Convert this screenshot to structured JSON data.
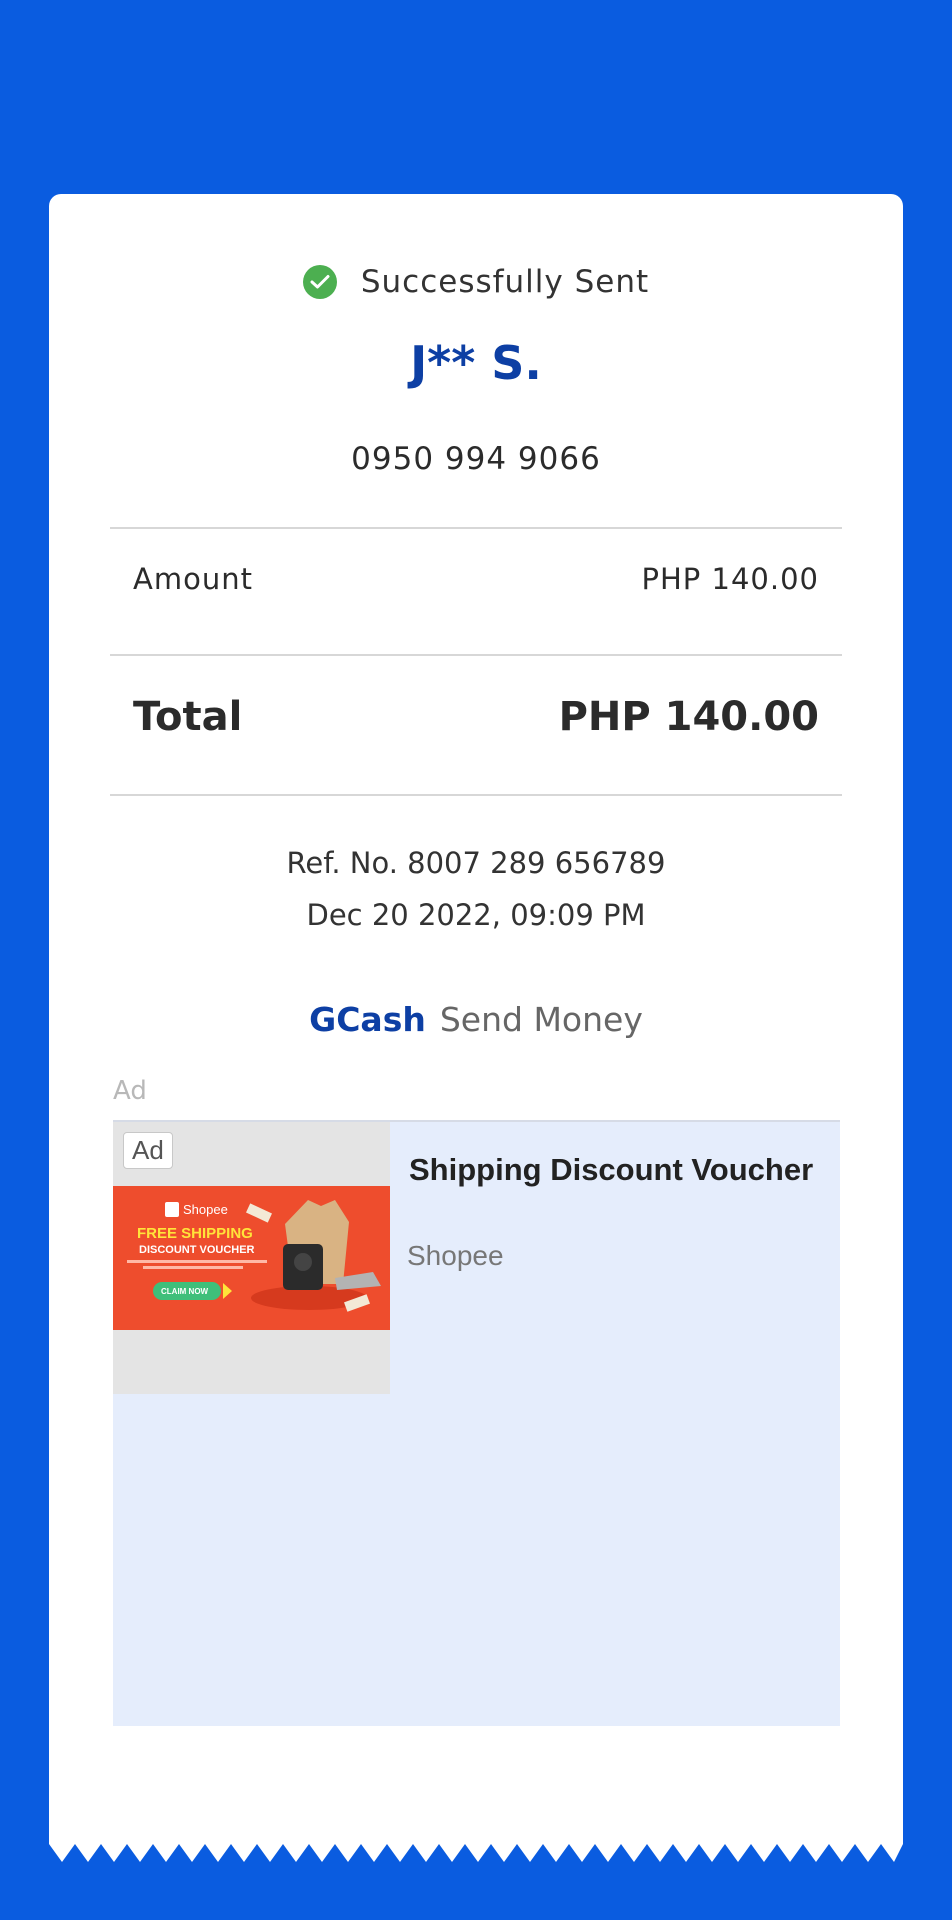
{
  "status": {
    "text": "Successfully Sent",
    "icon": "check-circle-icon",
    "color": "#4caf50"
  },
  "recipient": {
    "name": "J** S.",
    "phone": "0950 994 9066"
  },
  "amount": {
    "label": "Amount",
    "value": "PHP 140.00"
  },
  "total": {
    "label": "Total",
    "value": "PHP 140.00"
  },
  "reference": {
    "ref_no": "Ref. No. 8007 289 656789",
    "datetime": "Dec 20 2022, 09:09 PM"
  },
  "brand": {
    "name": "GCash",
    "service": "Send Money",
    "color": "#0d3fa4"
  },
  "ad": {
    "section_label": "Ad",
    "badge": "Ad",
    "title": "Shipping Discount Voucher",
    "advertiser": "Shopee",
    "banner": {
      "logo_text": "Shopee",
      "headline": "FREE SHIPPING",
      "subheadline": "DISCOUNT VOUCHER",
      "cta": "CLAIM NOW",
      "color": "#ee4d2d"
    }
  },
  "colors": {
    "background": "#0a5ce0",
    "card": "#ffffff",
    "ad_background": "#e5edfc"
  }
}
